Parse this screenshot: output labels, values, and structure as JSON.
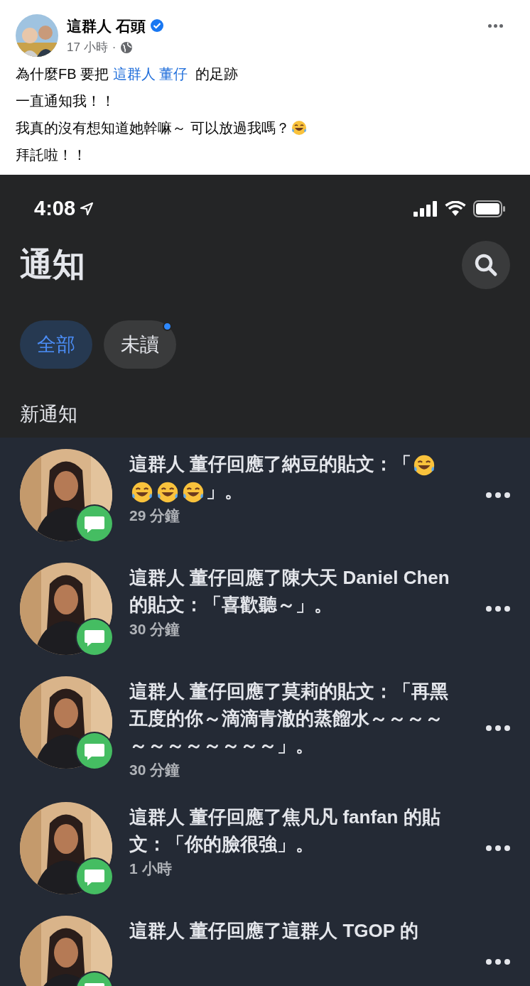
{
  "post": {
    "author": "這群人 石頭",
    "verified": true,
    "time": "17 小時",
    "audience_separator": "·",
    "lines": [
      {
        "segments": [
          {
            "kind": "text",
            "text": "為什麼FB 要把 "
          },
          {
            "kind": "link",
            "text": "這群人 董仔"
          },
          {
            "kind": "text",
            "text": "  的足跡"
          }
        ]
      },
      {
        "segments": [
          {
            "kind": "text",
            "text": "一直通知我！！"
          }
        ]
      },
      {
        "segments": [
          {
            "kind": "text",
            "text": "我真的沒有想知道她幹嘛～ 可以放過我嗎？"
          },
          {
            "kind": "emoji"
          }
        ]
      },
      {
        "segments": [
          {
            "kind": "text",
            "text": "拜託啦！！"
          }
        ]
      }
    ]
  },
  "phone": {
    "status_bar": {
      "time": "4:08"
    },
    "title": "通知",
    "tabs": [
      {
        "label": "全部",
        "selected": true,
        "unread_dot": false
      },
      {
        "label": "未讀",
        "selected": false,
        "unread_dot": true
      }
    ],
    "section_title": "新通知",
    "notifications": [
      {
        "unread": true,
        "segments": [
          {
            "kind": "text",
            "text": "這群人 董仔回應了納豆的貼文：「"
          },
          {
            "kind": "emoji"
          },
          {
            "kind": "emoji"
          },
          {
            "kind": "emoji"
          },
          {
            "kind": "emoji"
          },
          {
            "kind": "text",
            "text": "」。"
          }
        ],
        "time": "29 分鐘"
      },
      {
        "unread": true,
        "segments": [
          {
            "kind": "text",
            "text": "這群人 董仔回應了陳大天 **Daniel Chen** 的貼文：「喜歡聽～」。"
          }
        ],
        "time": "30 分鐘"
      },
      {
        "unread": true,
        "segments": [
          {
            "kind": "text",
            "text": "這群人 董仔回應了莫莉的貼文：「再黑五度的你～滴滴青澈的蒸餾水～～～～～～～～～～～～」。"
          }
        ],
        "time": "30 分鐘"
      },
      {
        "unread": true,
        "segments": [
          {
            "kind": "text",
            "text": "這群人 董仔回應了焦凡凡 **fanfan** 的貼文：「你的臉很強」。"
          }
        ],
        "time": "1 小時"
      },
      {
        "unread": true,
        "segments": [
          {
            "kind": "text",
            "text": "這群人 董仔回應了這群人 **TGOP** 的"
          }
        ]
      }
    ]
  }
}
